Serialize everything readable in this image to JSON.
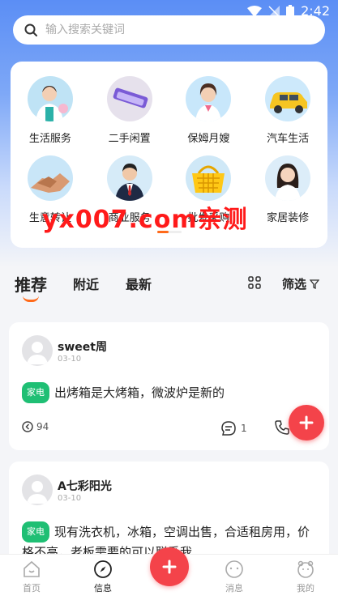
{
  "status_bar": {
    "time": "2:42"
  },
  "search": {
    "placeholder": "输入搜索关键词"
  },
  "categories": [
    {
      "label": "生活服务",
      "icon": "housekeeper-avatar"
    },
    {
      "label": "二手闲置",
      "icon": "phone-product-icon"
    },
    {
      "label": "保姆月嫂",
      "icon": "nanny-avatar"
    },
    {
      "label": "汽车生活",
      "icon": "car-icon"
    },
    {
      "label": "生意转让",
      "icon": "handshake-icon"
    },
    {
      "label": "商业服务",
      "icon": "businessman-avatar"
    },
    {
      "label": "批发采购",
      "icon": "shopping-basket-icon"
    },
    {
      "label": "家居装修",
      "icon": "woman-avatar"
    }
  ],
  "watermark": "yx007.com亲测",
  "tabs": {
    "recommend": "推荐",
    "nearby": "附近",
    "latest": "最新",
    "filter": "筛选"
  },
  "posts": [
    {
      "name": "sweet周",
      "date": "03-10",
      "tag": "家电",
      "text": "出烤箱是大烤箱，微波炉是新的",
      "views": "94",
      "comments": "1"
    },
    {
      "name": "A七彩阳光",
      "date": "03-10",
      "tag": "家电",
      "text": "现有洗衣机，冰箱，空调出售，合适租房用，价格不高，老板需要的可以联系我"
    }
  ],
  "bottom_nav": {
    "home": "首页",
    "info": "信息",
    "messages": "消息",
    "mine": "我的"
  },
  "colors": {
    "accent": "#f4434a",
    "tag": "#1fbf74",
    "header": "#5b8ef5",
    "tab_underline": "#ff6a1a"
  }
}
